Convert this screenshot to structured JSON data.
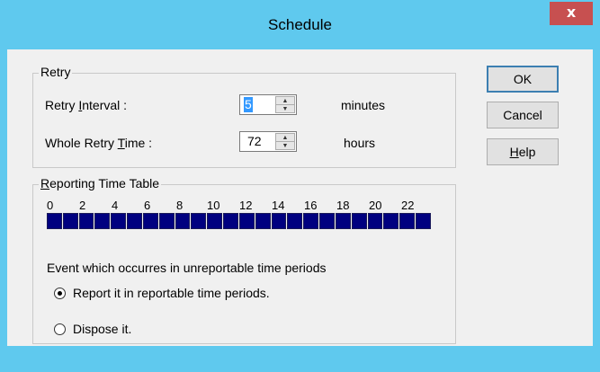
{
  "window": {
    "title": "Schedule",
    "close_label": "x"
  },
  "retry": {
    "group_label": "Retry",
    "interval_label": "Retry Interval :",
    "interval_value": "5",
    "interval_unit": "minutes",
    "whole_label": "Whole Retry Time :",
    "whole_value": "72",
    "whole_unit": "hours"
  },
  "buttons": {
    "ok": "OK",
    "cancel": "Cancel",
    "help": "Help"
  },
  "report": {
    "group_label": "Reporting Time Table",
    "hour_labels": [
      "0",
      "2",
      "4",
      "6",
      "8",
      "10",
      "12",
      "14",
      "16",
      "18",
      "20",
      "22"
    ],
    "slot_count": 24,
    "event_text": "Event which occurres in unreportable time periods",
    "option1": "Report it in reportable time periods.",
    "option2": "Dispose it.",
    "selected_option": 1
  },
  "colors": {
    "titlebar": "#5fc9ee",
    "close": "#c75050",
    "slot": "#000080",
    "selection": "#3399ff"
  }
}
